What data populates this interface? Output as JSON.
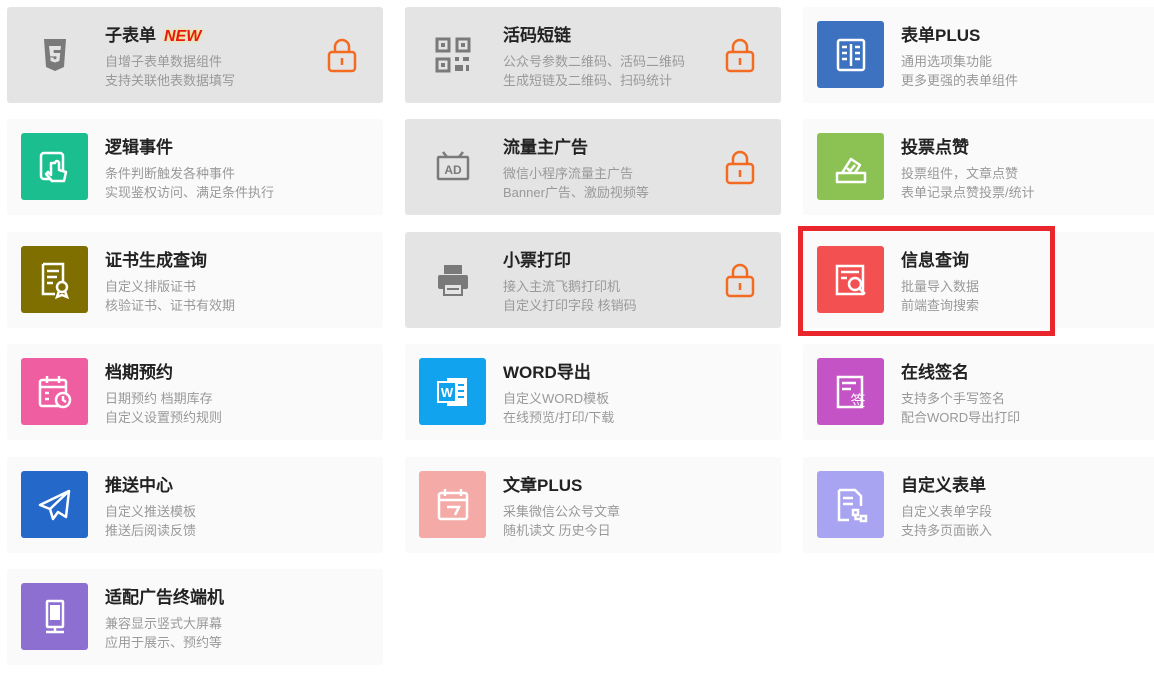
{
  "cards": [
    {
      "title": "子表单",
      "badge": "NEW",
      "desc1": "自增子表单数据组件",
      "desc2": "支持关联他表数据填写",
      "icon": "html5-icon",
      "icon_color": "#e4e4e4",
      "glyph": "#7a7a7a",
      "locked": true
    },
    {
      "title": "活码短链",
      "desc1": "公众号参数二维码、活码二维码",
      "desc2": "生成短链及二维码、扫码统计",
      "icon": "qrcode-icon",
      "icon_color": "#e4e4e4",
      "glyph": "#7a7a7a",
      "locked": true
    },
    {
      "title": "表单PLUS",
      "desc1": "通用选项集功能",
      "desc2": "更多更强的表单组件",
      "icon": "list-form-icon",
      "icon_color": "#3c72c0",
      "glyph": "#ffffff",
      "locked": false
    },
    {
      "title": "逻辑事件",
      "desc1": "条件判断触发各种事件",
      "desc2": "实现鉴权访问、满足条件执行",
      "icon": "tap-hand-icon",
      "icon_color": "#1bbf8f",
      "glyph": "#ffffff",
      "locked": false
    },
    {
      "title": "流量主广告",
      "desc1": "微信小程序流量主广告",
      "desc2": "Banner广告、激励视频等",
      "icon": "ad-icon",
      "icon_color": "#e4e4e4",
      "glyph": "#7a7a7a",
      "locked": true
    },
    {
      "title": "投票点赞",
      "desc1": "投票组件，文章点赞",
      "desc2": "表单记录点赞投票/统计",
      "icon": "vote-box-icon",
      "icon_color": "#8cc153",
      "glyph": "#ffffff",
      "locked": false
    },
    {
      "title": "证书生成查询",
      "desc1": "自定义排版证书",
      "desc2": "核验证书、证书有效期",
      "icon": "certificate-icon",
      "icon_color": "#7e6f00",
      "glyph": "#ffffff",
      "locked": false
    },
    {
      "title": "小票打印",
      "desc1": "接入主流飞鹅打印机",
      "desc2": "自定义打印字段 核销码",
      "icon": "printer-icon",
      "icon_color": "#e4e4e4",
      "glyph": "#7a7a7a",
      "locked": true
    },
    {
      "title": "信息查询",
      "desc1": "批量导入数据",
      "desc2": "前端查询搜索",
      "icon": "search-doc-icon",
      "icon_color": "#f35151",
      "glyph": "#ffffff",
      "locked": false
    },
    {
      "title": "档期预约",
      "desc1": "日期预约 档期库存",
      "desc2": "自定义设置预约规则",
      "icon": "calendar-clock-icon",
      "icon_color": "#ef5ea0",
      "glyph": "#ffffff",
      "locked": false
    },
    {
      "title": "WORD导出",
      "desc1": "自定义WORD模板",
      "desc2": "在线预览/打印/下载",
      "icon": "word-icon",
      "icon_color": "#12a3ee",
      "glyph": "#ffffff",
      "locked": false
    },
    {
      "title": "在线签名",
      "desc1": "支持多个手写签名",
      "desc2": "配合WORD导出打印",
      "icon": "signature-icon",
      "icon_color": "#c453c6",
      "glyph": "#ffffff",
      "locked": false
    },
    {
      "title": "推送中心",
      "desc1": "自定义推送模板",
      "desc2": "推送后阅读反馈",
      "icon": "paper-plane-icon",
      "icon_color": "#2469c9",
      "glyph": "#ffffff",
      "locked": false
    },
    {
      "title": "文章PLUS",
      "desc1": "采集微信公众号文章",
      "desc2": "随机读文 历史今日",
      "icon": "article-calendar-icon",
      "icon_color": "#f4aaa6",
      "glyph": "#ffffff",
      "locked": false
    },
    {
      "title": "自定义表单",
      "desc1": "自定义表单字段",
      "desc2": "支持多页面嵌入",
      "icon": "custom-form-icon",
      "icon_color": "#a9a4f1",
      "glyph": "#ffffff",
      "locked": false
    },
    {
      "title": "适配广告终端机",
      "desc1": "兼容显示竖式大屏幕",
      "desc2": "应用于展示、预约等",
      "icon": "kiosk-icon",
      "icon_color": "#8c6fd0",
      "glyph": "#ffffff",
      "locked": false
    }
  ],
  "colors": {
    "lock": "#f26b21",
    "highlight": "#e8262b",
    "new_badge": "#e8171b"
  }
}
